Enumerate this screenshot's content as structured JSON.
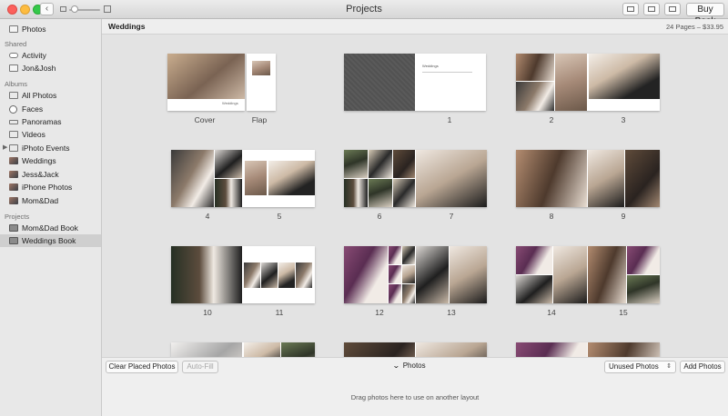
{
  "window": {
    "title": "Projects",
    "back_glyph": "‹",
    "buy_book_label": "Buy Book"
  },
  "sidebar": {
    "sections": [
      {
        "heading": "",
        "items": [
          {
            "label": "Photos",
            "icon": "photos-icon"
          }
        ]
      },
      {
        "heading": "Shared",
        "items": [
          {
            "label": "Activity",
            "icon": "cloud-icon"
          },
          {
            "label": "Jon&Josh",
            "icon": "shared-album-icon"
          }
        ]
      },
      {
        "heading": "Albums",
        "items": [
          {
            "label": "All Photos",
            "icon": "all-photos-icon"
          },
          {
            "label": "Faces",
            "icon": "faces-icon"
          },
          {
            "label": "Panoramas",
            "icon": "panorama-icon"
          },
          {
            "label": "Videos",
            "icon": "video-icon"
          },
          {
            "label": "iPhoto Events",
            "icon": "events-icon"
          },
          {
            "label": "Weddings",
            "icon": "album-thumbnail-icon"
          },
          {
            "label": "Jess&Jack",
            "icon": "album-thumbnail-icon"
          },
          {
            "label": "iPhone Photos",
            "icon": "album-thumbnail-icon"
          },
          {
            "label": "Mom&Dad",
            "icon": "album-thumbnail-icon"
          }
        ]
      },
      {
        "heading": "Projects",
        "items": [
          {
            "label": "Mom&Dad Book",
            "icon": "book-icon"
          },
          {
            "label": "Weddings Book",
            "icon": "book-icon",
            "selected": true
          }
        ]
      }
    ]
  },
  "header": {
    "title": "Weddings",
    "page_count": "24 Pages – $33.95"
  },
  "book": {
    "cover_title": "Weddings",
    "labels": [
      "Cover",
      "Flap",
      "1",
      "2",
      "3",
      "4",
      "5",
      "6",
      "7",
      "8",
      "9",
      "10",
      "11",
      "12",
      "13",
      "14",
      "15"
    ]
  },
  "bottom": {
    "clear_label": "Clear Placed Photos",
    "autofill_label": "Auto-Fill",
    "chevron": "⌄",
    "photos_label": "Photos",
    "filter_label": "Unused Photos",
    "add_label": "Add Photos",
    "hint": "Drag photos here to use on another layout"
  },
  "colors": {
    "sidebar_bg": "#e8e8e8",
    "selected_bg": "#cfcfcf",
    "canvas_bg": "#e3e3e3"
  }
}
